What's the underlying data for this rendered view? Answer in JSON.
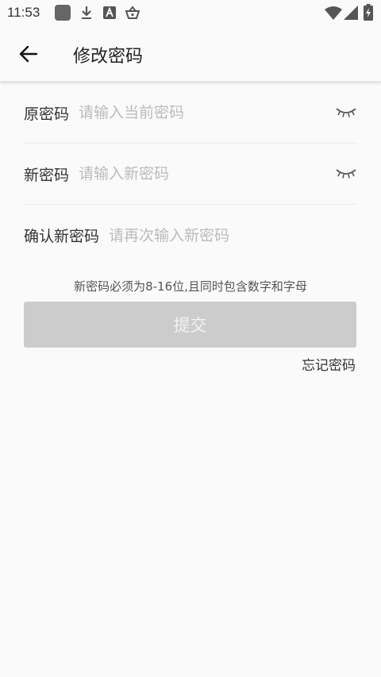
{
  "status_bar": {
    "time": "11:53",
    "icons": [
      "app-square-icon",
      "download-icon",
      "font-a-icon",
      "basket-icon",
      "wifi-icon",
      "signal-icon",
      "battery-charging-icon"
    ]
  },
  "header": {
    "title": "修改密码",
    "back_icon": "arrow-left-icon"
  },
  "form": {
    "old_password": {
      "label": "原密码",
      "placeholder": "请输入当前密码",
      "value": ""
    },
    "new_password": {
      "label": "新密码",
      "placeholder": "请输入新密码",
      "value": ""
    },
    "confirm_password": {
      "label": "确认新密码",
      "placeholder": "请再次输入新密码",
      "value": ""
    },
    "hint": "新密码必须为8-16位,且同时包含数字和字母",
    "submit_label": "提交",
    "forgot_label": "忘记密码"
  },
  "colors": {
    "background": "#fafafa",
    "submit_disabled": "#cccccc",
    "placeholder": "#bbbbbb",
    "text": "#333333"
  }
}
